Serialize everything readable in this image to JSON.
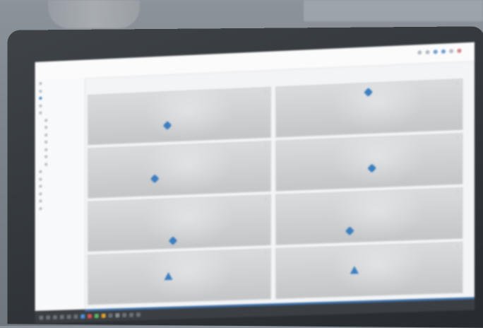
{
  "window": {
    "breadcrumb": "",
    "page_crumb": "",
    "grid_title": ""
  },
  "sidebar": {
    "items": [
      {
        "label": "",
        "active": false,
        "sub": false
      },
      {
        "label": "",
        "active": false,
        "sub": false
      },
      {
        "label": "",
        "active": true,
        "sub": false
      },
      {
        "label": "",
        "active": false,
        "sub": false
      },
      {
        "label": "",
        "active": false,
        "sub": false
      },
      {
        "label": "",
        "active": false,
        "sub": true
      },
      {
        "label": "",
        "active": false,
        "sub": true
      },
      {
        "label": "",
        "active": false,
        "sub": true
      },
      {
        "label": "",
        "active": false,
        "sub": true
      },
      {
        "label": "",
        "active": false,
        "sub": true
      },
      {
        "label": "",
        "active": false,
        "sub": true
      },
      {
        "label": "",
        "active": false,
        "sub": true
      },
      {
        "label": "",
        "active": false,
        "sub": false
      },
      {
        "label": "",
        "active": false,
        "sub": false
      },
      {
        "label": "",
        "active": false,
        "sub": false
      },
      {
        "label": "",
        "active": false,
        "sub": false
      },
      {
        "label": "",
        "active": false,
        "sub": false
      },
      {
        "label": "",
        "active": false,
        "sub": false
      }
    ]
  },
  "tiles": [
    {
      "name": "",
      "meta": "",
      "marker": "diamond"
    },
    {
      "name": "",
      "meta": "",
      "marker": "diamond"
    },
    {
      "name": "",
      "meta": "",
      "marker": "diamond"
    },
    {
      "name": "",
      "meta": "",
      "marker": "diamond"
    },
    {
      "name": "",
      "meta": "",
      "marker": "diamond"
    },
    {
      "name": "",
      "meta": "",
      "marker": "diamond"
    },
    {
      "name": "",
      "meta": "",
      "marker": "triangle"
    },
    {
      "name": "",
      "meta": "",
      "marker": "triangle"
    }
  ],
  "colors": {
    "accent": "#3d7fc1",
    "taskbar": "#3b3f44",
    "bezel": "#2e3338"
  },
  "icons": [
    "search-icon",
    "user-icon",
    "settings-icon",
    "notification-icon",
    "grid-icon",
    "help-icon"
  ]
}
